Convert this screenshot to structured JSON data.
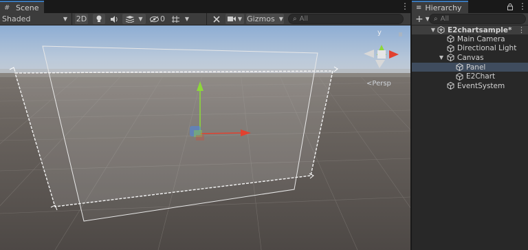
{
  "scene": {
    "tab_label": "Scene",
    "tab_icon": "grid-icon",
    "menu_glyph": "⋮",
    "toolbar": {
      "shading_mode": "Shaded",
      "mode_2d": "2D",
      "hidden_count": "0",
      "gizmos_label": "Gizmos",
      "search_placeholder": "All"
    },
    "projection_label": "Persp",
    "gizmo_axis_label": "y"
  },
  "hierarchy": {
    "tab_label": "Hierarchy",
    "add_glyph": "+",
    "search_placeholder": "All",
    "scene_name": "E2chartsample*",
    "items": [
      {
        "label": "Main Camera",
        "depth": 1
      },
      {
        "label": "Directional Light",
        "depth": 1
      },
      {
        "label": "Canvas",
        "depth": 1,
        "expanded": true
      },
      {
        "label": "Panel",
        "depth": 2,
        "selected": true
      },
      {
        "label": "E2Chart",
        "depth": 2
      },
      {
        "label": "EventSystem",
        "depth": 1
      }
    ]
  },
  "colors": {
    "accent": "#3a79bb",
    "selection": "#3f4c5e",
    "axis_x": "#e2412f",
    "axis_y": "#8dd839",
    "axis_z": "#4a86e8"
  }
}
